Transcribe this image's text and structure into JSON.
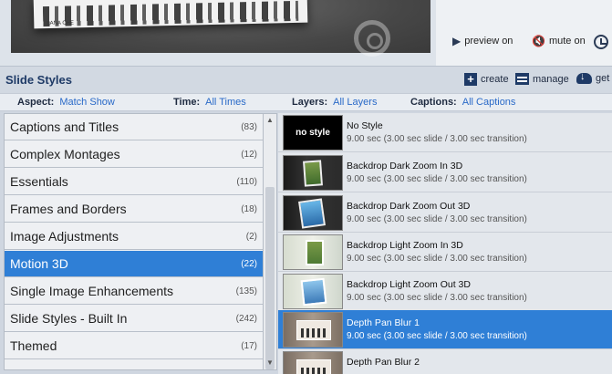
{
  "preview": {
    "photo_caption": "LANA CHE",
    "controls": {
      "preview": "preview on",
      "mute": "mute on"
    }
  },
  "header": {
    "title": "Slide Styles",
    "create": "create",
    "manage": "manage",
    "get": "get"
  },
  "filters": {
    "aspect_label": "Aspect:",
    "aspect_value": "Match Show",
    "time_label": "Time:",
    "time_value": "All Times",
    "layers_label": "Layers:",
    "layers_value": "All Layers",
    "captions_label": "Captions:",
    "captions_value": "All Captions"
  },
  "categories": [
    {
      "name": "Captions and Titles",
      "count": "(83)"
    },
    {
      "name": "Complex Montages",
      "count": "(12)"
    },
    {
      "name": "Essentials",
      "count": "(110)"
    },
    {
      "name": "Frames and Borders",
      "count": "(18)"
    },
    {
      "name": "Image Adjustments",
      "count": "(2)"
    },
    {
      "name": "Motion 3D",
      "count": "(22)"
    },
    {
      "name": "Single Image Enhancements",
      "count": "(135)"
    },
    {
      "name": "Slide Styles - Built In",
      "count": "(242)"
    },
    {
      "name": "Themed",
      "count": "(17)"
    }
  ],
  "selected_category": "Motion 3D",
  "styles": [
    {
      "name": "No Style",
      "duration": "9.00 sec (3.00 sec slide / 3.00 sec transition)",
      "thumb_text": "no style"
    },
    {
      "name": "Backdrop Dark Zoom In 3D",
      "duration": "9.00 sec (3.00 sec slide / 3.00 sec transition)"
    },
    {
      "name": "Backdrop Dark Zoom Out 3D",
      "duration": "9.00 sec (3.00 sec slide / 3.00 sec transition)"
    },
    {
      "name": "Backdrop Light Zoom In 3D",
      "duration": "9.00 sec (3.00 sec slide / 3.00 sec transition)"
    },
    {
      "name": "Backdrop Light Zoom Out 3D",
      "duration": "9.00 sec (3.00 sec slide / 3.00 sec transition)"
    },
    {
      "name": "Depth Pan Blur 1",
      "duration": "9.00 sec (3.00 sec slide / 3.00 sec transition)"
    },
    {
      "name": "Depth Pan Blur 2",
      "duration": ""
    }
  ],
  "selected_style": "Depth Pan Blur 1",
  "colors": {
    "selection": "#2f7fd6",
    "title": "#1e3a66",
    "link": "#2a6ac8"
  }
}
